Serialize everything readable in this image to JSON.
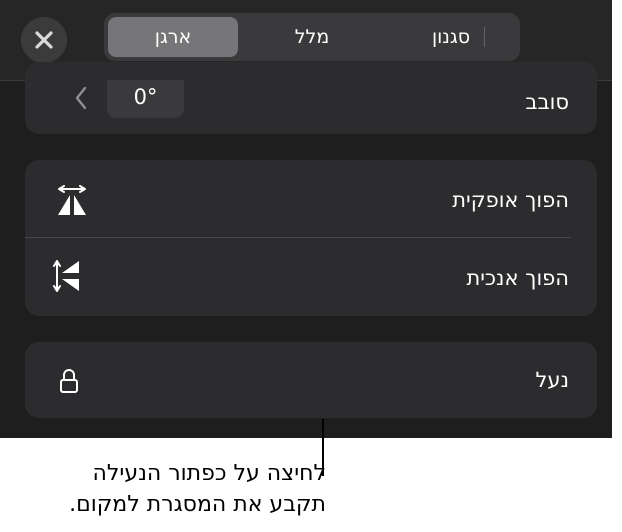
{
  "header": {
    "close_icon": "close-icon",
    "tabs": [
      {
        "label": "סגנון",
        "selected": false
      },
      {
        "label": "מלל",
        "selected": false
      },
      {
        "label": "ארגן",
        "selected": true
      }
    ]
  },
  "rotate": {
    "label": "סובב",
    "value": "0°"
  },
  "flip": {
    "horizontal_label": "הפוך אופקית",
    "vertical_label": "הפוך אנכית"
  },
  "lock": {
    "label": "נעל"
  },
  "callout": {
    "line1": "לחיצה על כפתור הנעילה",
    "line2": "תקבע את המסגרת למקום."
  },
  "colors": {
    "panel": "#1e1e1e",
    "card": "#2c2c2e",
    "selected_tab": "#767678"
  }
}
